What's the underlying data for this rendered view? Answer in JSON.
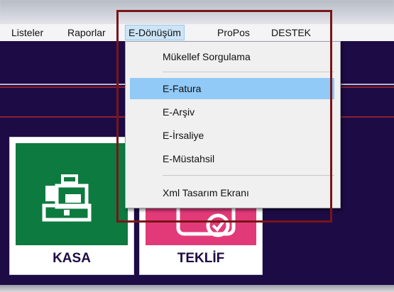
{
  "menubar": {
    "items": [
      "Listeler",
      "Raporlar",
      "E-Dönüşüm",
      "ProPos",
      "DESTEK"
    ],
    "active": "E-Dönüşüm"
  },
  "dropdown": {
    "items": [
      {
        "label": "Mükellef Sorgulama"
      },
      {
        "label": "E-Fatura"
      },
      {
        "label": "E-Arşiv"
      },
      {
        "label": "E-İrsaliye"
      },
      {
        "label": "E-Müstahsil"
      },
      {
        "label": "Xml Tasarım Ekranı"
      }
    ],
    "highlighted": "E-Fatura"
  },
  "tiles": {
    "kasa": {
      "label": "KASA",
      "color": "#0d7a3f",
      "icon": "cash-register-icon"
    },
    "teklif": {
      "label": "TEKLİF",
      "color": "#e23a78",
      "icon": "offer-icon"
    }
  },
  "colors": {
    "app_background": "#1d0b45",
    "highlight_frame": "#7a1418",
    "menu_hover": "#91c9f7"
  }
}
